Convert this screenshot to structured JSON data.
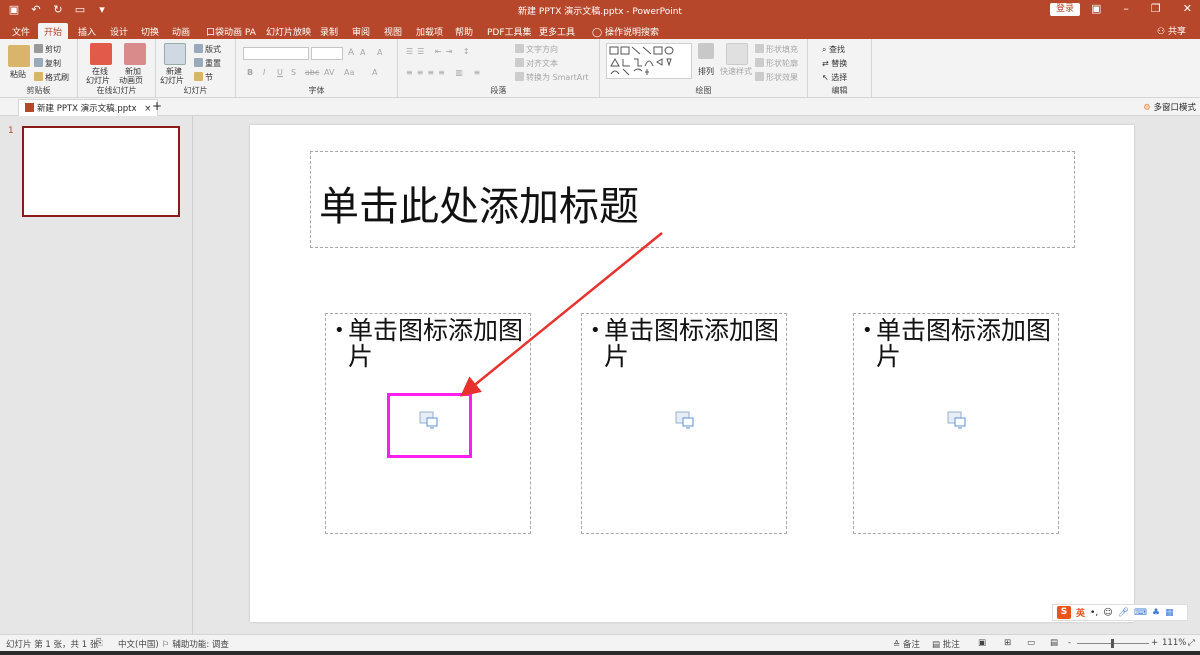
{
  "titlebar": {
    "title": "新建 PPTX 演示文稿.pptx - PowerPoint",
    "login": "登录",
    "qat_icons": [
      "save-icon",
      "undo-icon",
      "redo-icon",
      "present-icon",
      "customize-icon"
    ],
    "window_buttons": [
      "ribbon-display-icon",
      "minimize-icon",
      "restore-icon",
      "close-icon"
    ]
  },
  "tabs": {
    "items": [
      "文件",
      "开始",
      "插入",
      "设计",
      "切换",
      "动画",
      "口袋动画 PA",
      "幻灯片放映",
      "录制",
      "审阅",
      "视图",
      "加载项",
      "帮助",
      "PDF工具集",
      "更多工具"
    ],
    "active": "开始",
    "search": "操作说明搜索",
    "share": "共享"
  },
  "ribbon": {
    "clipboard": {
      "paste": "粘贴",
      "cut": "剪切",
      "copy": "复制",
      "format_painter": "格式刷",
      "label": "剪贴板"
    },
    "online_slides": {
      "online": "在线",
      "online2": "幻灯片",
      "new_anim": "新加",
      "new_anim2": "动画页",
      "label": "在线幻灯片"
    },
    "slides": {
      "new": "新建",
      "new2": "幻灯片",
      "layout": "版式",
      "reset": "重置",
      "section": "节",
      "label": "幻灯片"
    },
    "font": {
      "label": "字体",
      "bold": "B",
      "italic": "I",
      "underline": "U",
      "shadow": "S",
      "strike": "abc",
      "spacing": "AV",
      "case": "Aa",
      "grow": "A",
      "shrink": "A",
      "clear": "A"
    },
    "paragraph": {
      "label": "段落",
      "text_direction": "文字方向",
      "align_text": "对齐文本",
      "smartart": "转换为 SmartArt"
    },
    "drawing": {
      "label": "绘图",
      "arrange": "排列",
      "quick_styles": "快速样式",
      "fill": "形状填充",
      "outline": "形状轮廓",
      "effects": "形状效果"
    },
    "editing": {
      "label": "编辑",
      "find": "查找",
      "replace": "替换",
      "select": "选择"
    }
  },
  "doctab": {
    "name": "新建 PPTX 演示文稿.pptx",
    "close": "×",
    "add": "+",
    "multi_window": "多窗口模式"
  },
  "thumbnails": [
    {
      "number": "1"
    }
  ],
  "slide": {
    "title_placeholder": "单击此处添加标题",
    "content_placeholders": [
      {
        "text": "单击图标添加图片"
      },
      {
        "text": "单击图标添加图片"
      },
      {
        "text": "单击图标添加图片"
      }
    ]
  },
  "ime": {
    "lang": "英"
  },
  "statusbar": {
    "slide_info": "幻灯片 第 1 张，共 1 张",
    "language": "中文(中国)",
    "accessibility": "辅助功能: 调查",
    "notes": "备注",
    "comments": "批注",
    "zoom": "111%",
    "zoom_out": "-",
    "zoom_in": "+"
  },
  "colors": {
    "accent": "#b7472a",
    "highlight": "#ff1ef0",
    "arrow": "#e8322e"
  }
}
